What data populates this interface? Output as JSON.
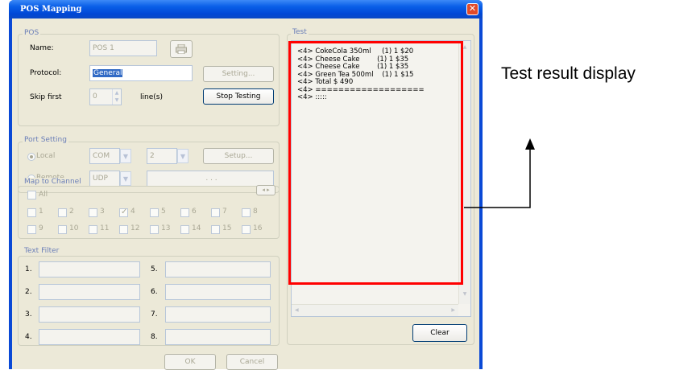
{
  "window": {
    "title": "POS Mapping",
    "close_glyph": "✕"
  },
  "pos": {
    "group_label": "POS",
    "name_label": "Name:",
    "name_value": "POS 1",
    "protocol_label": "Protocol:",
    "protocol_value": "General",
    "setting_button": "Setting...",
    "skip_label": "Skip first",
    "skip_value": "0",
    "lines_label": "line(s)",
    "stop_button": "Stop Testing"
  },
  "port": {
    "group_label": "Port Setting",
    "local_label": "Local",
    "local_type": "COM",
    "local_port": "2",
    "setup_button": "Setup...",
    "remote_label": "Remote",
    "remote_type": "UDP",
    "ip_dots": ".      .      ."
  },
  "channel": {
    "group_label": "Map to Channel",
    "all_label": "All",
    "nav_label": "◂ ▸",
    "channels": [
      "1",
      "2",
      "3",
      "4",
      "5",
      "6",
      "7",
      "8",
      "9",
      "10",
      "11",
      "12",
      "13",
      "14",
      "15",
      "16"
    ],
    "checked": [
      "4"
    ]
  },
  "filter": {
    "group_label": "Text Filter",
    "labels": [
      "1.",
      "2.",
      "3.",
      "4.",
      "5.",
      "6.",
      "7.",
      "8."
    ]
  },
  "test": {
    "group_label": "Test",
    "lines": [
      "<4> CokeCola 350ml     (1) 1 $20",
      "<4> Cheese Cake        (1) 1 $35",
      "<4> Cheese Cake        (1) 1 $35",
      "<4> Green Tea 500ml    (1) 1 $15",
      "<4> Total $ 490",
      "<4> ===================",
      "<4> :::::"
    ],
    "clear_button": "Clear"
  },
  "footer": {
    "ok_button": "OK",
    "cancel_button": "Cancel"
  },
  "annotation": {
    "label": "Test result display"
  },
  "colors": {
    "highlight": "#ff0000",
    "titlebar": "#0a5fe8",
    "client": "#ece9d8"
  }
}
